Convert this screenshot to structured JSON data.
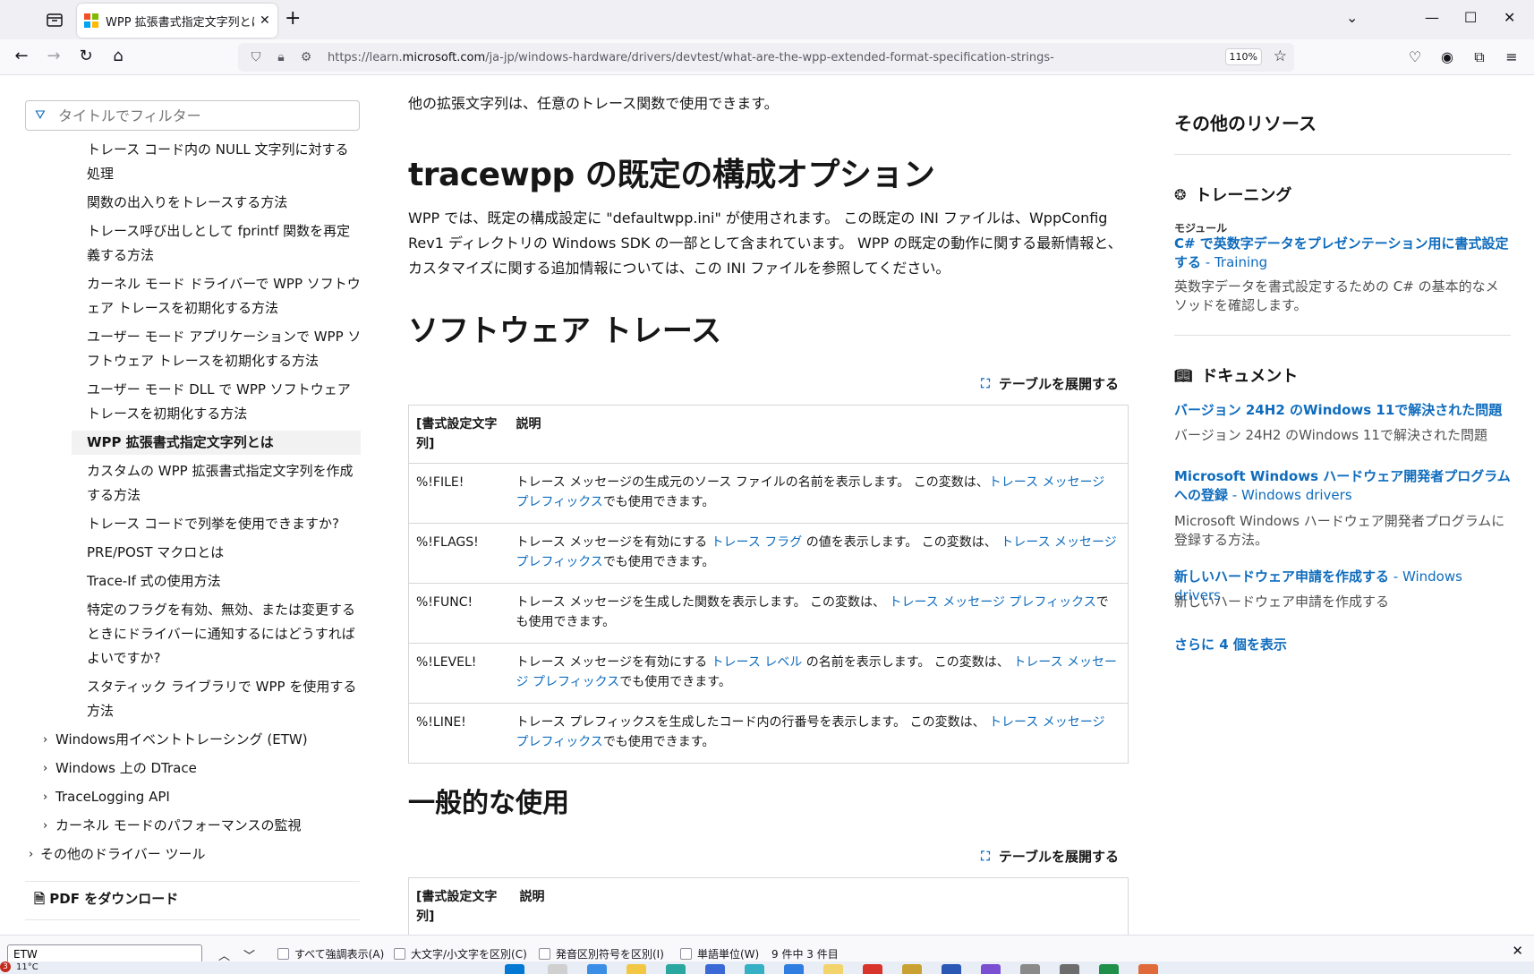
{
  "browser": {
    "tab_title": "WPP 拡張書式指定文字列とは - ",
    "tab_close": "✕",
    "new_tab": "+",
    "url_prefix": "https://learn.",
    "url_domain": "microsoft.com",
    "url_path": "/ja-jp/windows-hardware/drivers/devtest/what-are-the-wpp-extended-format-specification-strings-",
    "zoom": "110%"
  },
  "toc": {
    "filter_placeholder": "タイトルでフィルター",
    "items": [
      "トレース コード内の NULL 文字列に対する処理",
      "関数の出入りをトレースする方法",
      "トレース呼び出しとして fprintf 関数を再定義する方法",
      "カーネル モード ドライバーで WPP ソフトウェア トレースを初期化する方法",
      "ユーザー モード アプリケーションで WPP ソフトウェア トレースを初期化する方法",
      "ユーザー モード DLL で WPP ソフトウェア トレースを初期化する方法",
      "WPP 拡張書式指定文字列とは",
      "カスタムの WPP 拡張書式指定文字列を作成する方法",
      "トレース コードで列挙を使用できますか?",
      "PRE/POST マクロとは",
      "Trace-If 式の使用方法",
      "特定のフラグを有効、無効、または変更するときにドライバーに通知するにはどうすればよいですか?",
      "スタティック ライブラリで WPP を使用する方法"
    ],
    "groups": [
      "Windows用イベントトレーシング (ETW)",
      "Windows 上の DTrace",
      "TraceLogging API",
      "カーネル モードのパフォーマンスの監視"
    ],
    "top_group": "その他のドライバー ツール",
    "pdf": "PDF をダウンロード"
  },
  "main": {
    "intro": "他の拡張文字列は、任意のトレース関数で使用できます。",
    "h_config": "tracewpp の既定の構成オプション",
    "config_para": "WPP では、既定の構成設定に \"defaultwpp.ini\" が使用されます。 この既定の INI ファイルは、WppConfig Rev1 ディレクトリの Windows SDK の一部として含まれています。 WPP の既定の動作に関する最新情報と、カスタマイズに関する追加情報については、この INI ファイルを参照してください。",
    "h_software": "ソフトウェア トレース",
    "expand_label": "テーブルを展開する",
    "table1": {
      "col1": "[書式設定文字列]",
      "col2": "説明",
      "rows": [
        {
          "key": "%!FILE!",
          "pre": "トレース メッセージの生成元のソース ファイルの名前を表示します。 この変数は、",
          "link1": "",
          "mid": "",
          "link2": "トレース メッセージ プレフィックス",
          "post": "でも使用できます。"
        },
        {
          "key": "%!FLAGS!",
          "pre": "トレース メッセージを有効にする ",
          "link1": "トレース フラグ",
          "mid": " の値を表示します。 この変数は、 ",
          "link2": "トレース メッセージ プレフィックス",
          "post": "でも使用できます。"
        },
        {
          "key": "%!FUNC!",
          "pre": "トレース メッセージを生成した関数を表示します。 この変数は、 ",
          "link1": "",
          "mid": "",
          "link2": "トレース メッセージ プレフィックス",
          "post": "でも使用できます。"
        },
        {
          "key": "%!LEVEL!",
          "pre": "トレース メッセージを有効にする ",
          "link1": "トレース レベル",
          "mid": " の名前を表示します。 この変数は、 ",
          "link2": "トレース メッセージ プレフィックス",
          "post": "でも使用できます。"
        },
        {
          "key": "%!LINE!",
          "pre": "トレース プレフィックスを生成したコード内の行番号を表示します。 この変数は、 ",
          "link1": "",
          "mid": "",
          "link2": "トレース メッセージ プレフィックス",
          "post": "でも使用できます。"
        }
      ]
    },
    "h_usage": "一般的な使用",
    "table2": {
      "col1": "[書式設定文字列]",
      "col2": "説明"
    }
  },
  "rail": {
    "title": "その他のリソース",
    "training_heading": "トレーニング",
    "module_label": "モジュール",
    "training_link": "C# で英数字データをプレゼンテーション用に書式設定する",
    "training_suffix": " - Training",
    "training_desc": "英数字データを書式設定するための C# の基本的なメソッドを確認します。",
    "docs_heading": "ドキュメント",
    "doc1_link": "バージョン 24H2 のWindows 11で解決された問題",
    "doc1_desc": "バージョン 24H2 のWindows 11で解決された問題",
    "doc2_link": "Microsoft Windows ハードウェア開発者プログラムへの登録",
    "doc2_suffix": " - Windows drivers",
    "doc2_desc": "Microsoft Windows ハードウェア開発者プログラムに登録する方法。",
    "doc3_link": "新しいハードウェア申請を作成する",
    "doc3_suffix": " - Windows drivers",
    "doc3_desc": "新しいハードウェア申請を作成する",
    "show_more": "さらに 4 個を表示"
  },
  "findbar": {
    "query": "ETW",
    "opt_highlight": "すべて強調表示(A)",
    "opt_case": "大文字/小文字を区別(C)",
    "opt_diacritics": "発音区別符号を区別(I)",
    "opt_whole": "単語単位(W)",
    "count": "9 件中 3 件目"
  },
  "taskbar": {
    "badge": "3",
    "temperature": "11°C"
  },
  "colors": {
    "link": "#0f6cbd",
    "accent_red": "#f25022",
    "accent_green": "#7fba00",
    "accent_blue": "#00a4ef",
    "accent_yellow": "#ffb900"
  }
}
